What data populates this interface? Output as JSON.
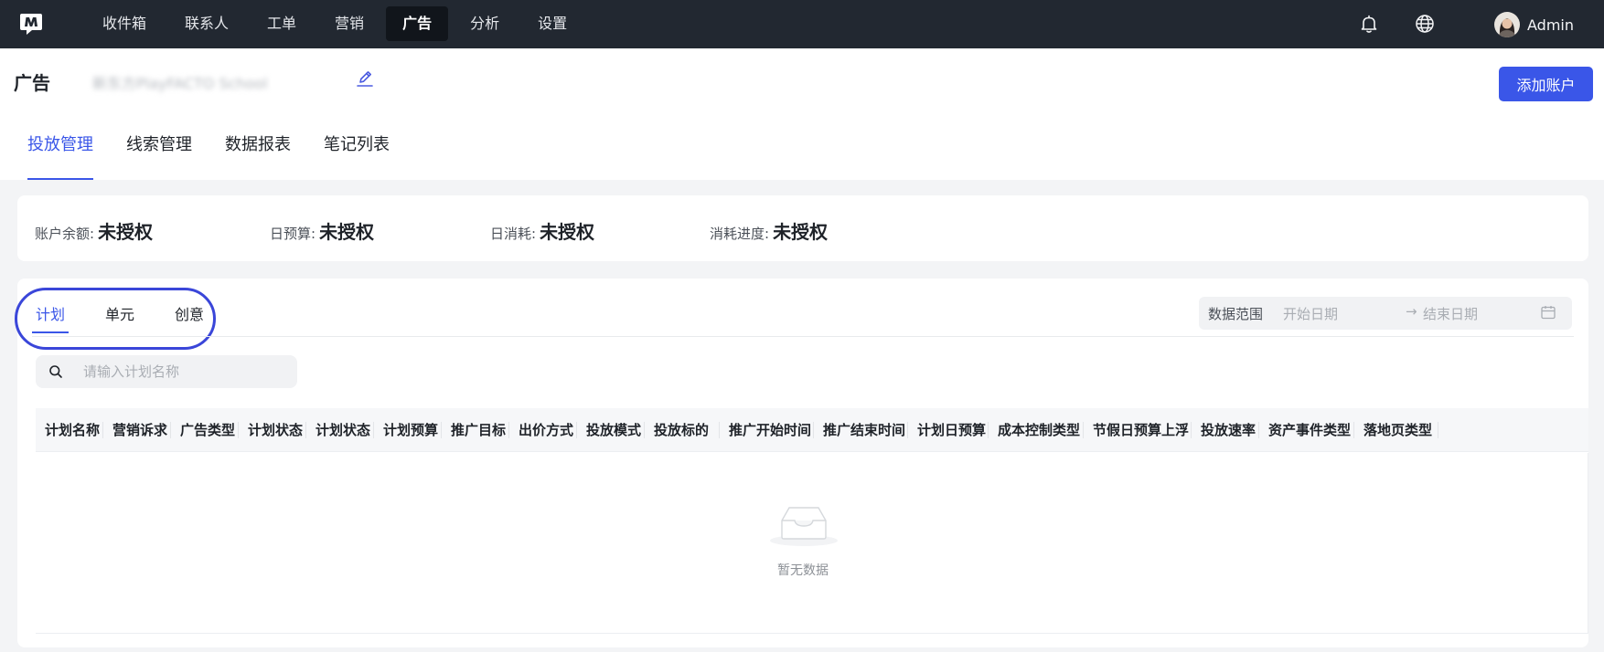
{
  "nav": {
    "items": [
      {
        "label": "收件箱"
      },
      {
        "label": "联系人"
      },
      {
        "label": "工单"
      },
      {
        "label": "营销"
      },
      {
        "label": "广告",
        "active": true
      },
      {
        "label": "分析"
      },
      {
        "label": "设置"
      }
    ],
    "user_name": "Admin"
  },
  "header": {
    "title": "广告",
    "account_name": "新东方PlayFACTO School",
    "add_account_label": "添加账户"
  },
  "main_tabs": [
    {
      "label": "投放管理",
      "active": true
    },
    {
      "label": "线索管理"
    },
    {
      "label": "数据报表"
    },
    {
      "label": "笔记列表"
    }
  ],
  "stats": [
    {
      "label": "账户余额:",
      "value": "未授权"
    },
    {
      "label": "日预算:",
      "value": "未授权"
    },
    {
      "label": "日消耗:",
      "value": "未授权"
    },
    {
      "label": "消耗进度:",
      "value": "未授权"
    }
  ],
  "sub_tabs": [
    {
      "label": "计划",
      "active": true
    },
    {
      "label": "单元"
    },
    {
      "label": "创意"
    }
  ],
  "date_range": {
    "label": "数据范围",
    "start_placeholder": "开始日期",
    "arrow": "→",
    "end_placeholder": "结束日期"
  },
  "search": {
    "placeholder": "请输入计划名称"
  },
  "table": {
    "columns": [
      "计划名称",
      "营销诉求",
      "广告类型",
      "计划状态",
      "计划状态",
      "计划预算",
      "推广目标",
      "出价方式",
      "投放模式",
      "投放标的",
      "推广开始时间",
      "推广结束时间",
      "计划日预算",
      "成本控制类型",
      "节假日预算上浮",
      "投放速率",
      "资产事件类型",
      "落地页类型"
    ],
    "empty_text": "暂无数据"
  },
  "colors": {
    "topbar": "#222831",
    "accent": "#3a56e8",
    "annotation_circle": "#3a46d9"
  }
}
